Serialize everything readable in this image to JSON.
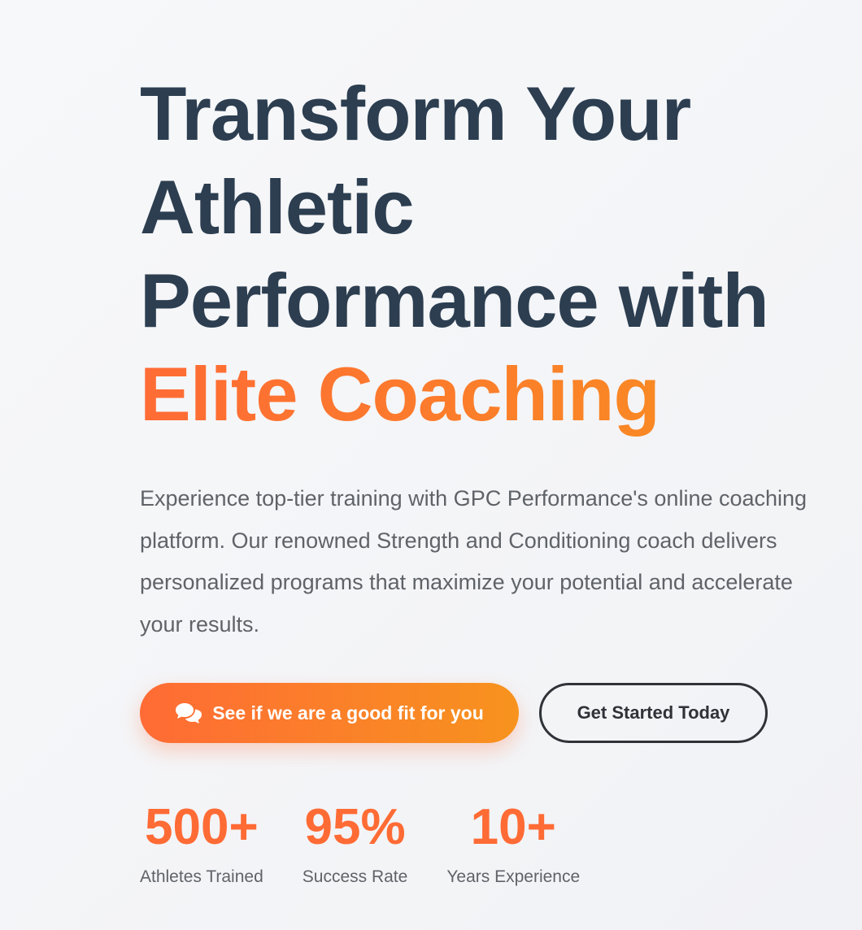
{
  "hero": {
    "headline_line1": "Transform Your",
    "headline_line2": "Athletic",
    "headline_line3": "Performance with",
    "headline_accent": "Elite Coaching",
    "description": "Experience top-tier training with GPC Performance's online coaching platform. Our renowned Strength and Conditioning coach delivers personalized programs that maximize your potential and accelerate your results."
  },
  "actions": {
    "primary_label": "See if we are a good fit for you",
    "primary_icon": "comments-icon",
    "secondary_label": "Get Started Today"
  },
  "stats": [
    {
      "value": "500+",
      "label": "Athletes Trained"
    },
    {
      "value": "95%",
      "label": "Success Rate"
    },
    {
      "value": "10+",
      "label": "Years Experience"
    }
  ],
  "colors": {
    "heading": "#2c3e50",
    "accent_start": "#ff6b35",
    "accent_end": "#f7931e",
    "body_text": "#5f6368",
    "outline_button": "#2f3237"
  }
}
